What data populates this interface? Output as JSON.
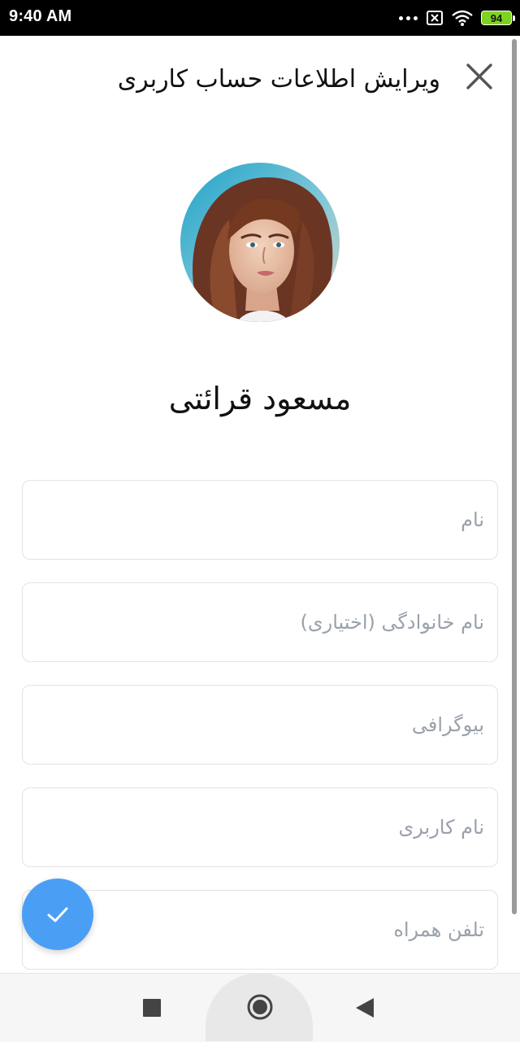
{
  "status_bar": {
    "time": "9:40 AM",
    "battery": "94",
    "icons": [
      "more-dots-icon",
      "sim-x-icon",
      "wifi-icon",
      "battery-icon"
    ]
  },
  "header": {
    "title": "ویرایش اطلاعات حساب کاربری",
    "close_icon": "close-icon"
  },
  "profile": {
    "name": "مسعود قرائتی"
  },
  "form": {
    "fields": [
      {
        "placeholder": "نام",
        "value": ""
      },
      {
        "placeholder": "نام خانوادگی (اختیاری)",
        "value": ""
      },
      {
        "placeholder": "بیوگرافی",
        "value": ""
      },
      {
        "placeholder": "نام کاربری",
        "value": ""
      },
      {
        "placeholder": "تلفن همراه",
        "value": ""
      }
    ]
  },
  "fab": {
    "icon": "check-icon"
  },
  "nav_bar": {
    "icons": [
      "recents-square-icon",
      "home-circle-icon",
      "back-triangle-icon"
    ]
  },
  "colors": {
    "accent": "#4a9ff5",
    "battery": "#7ed321"
  }
}
